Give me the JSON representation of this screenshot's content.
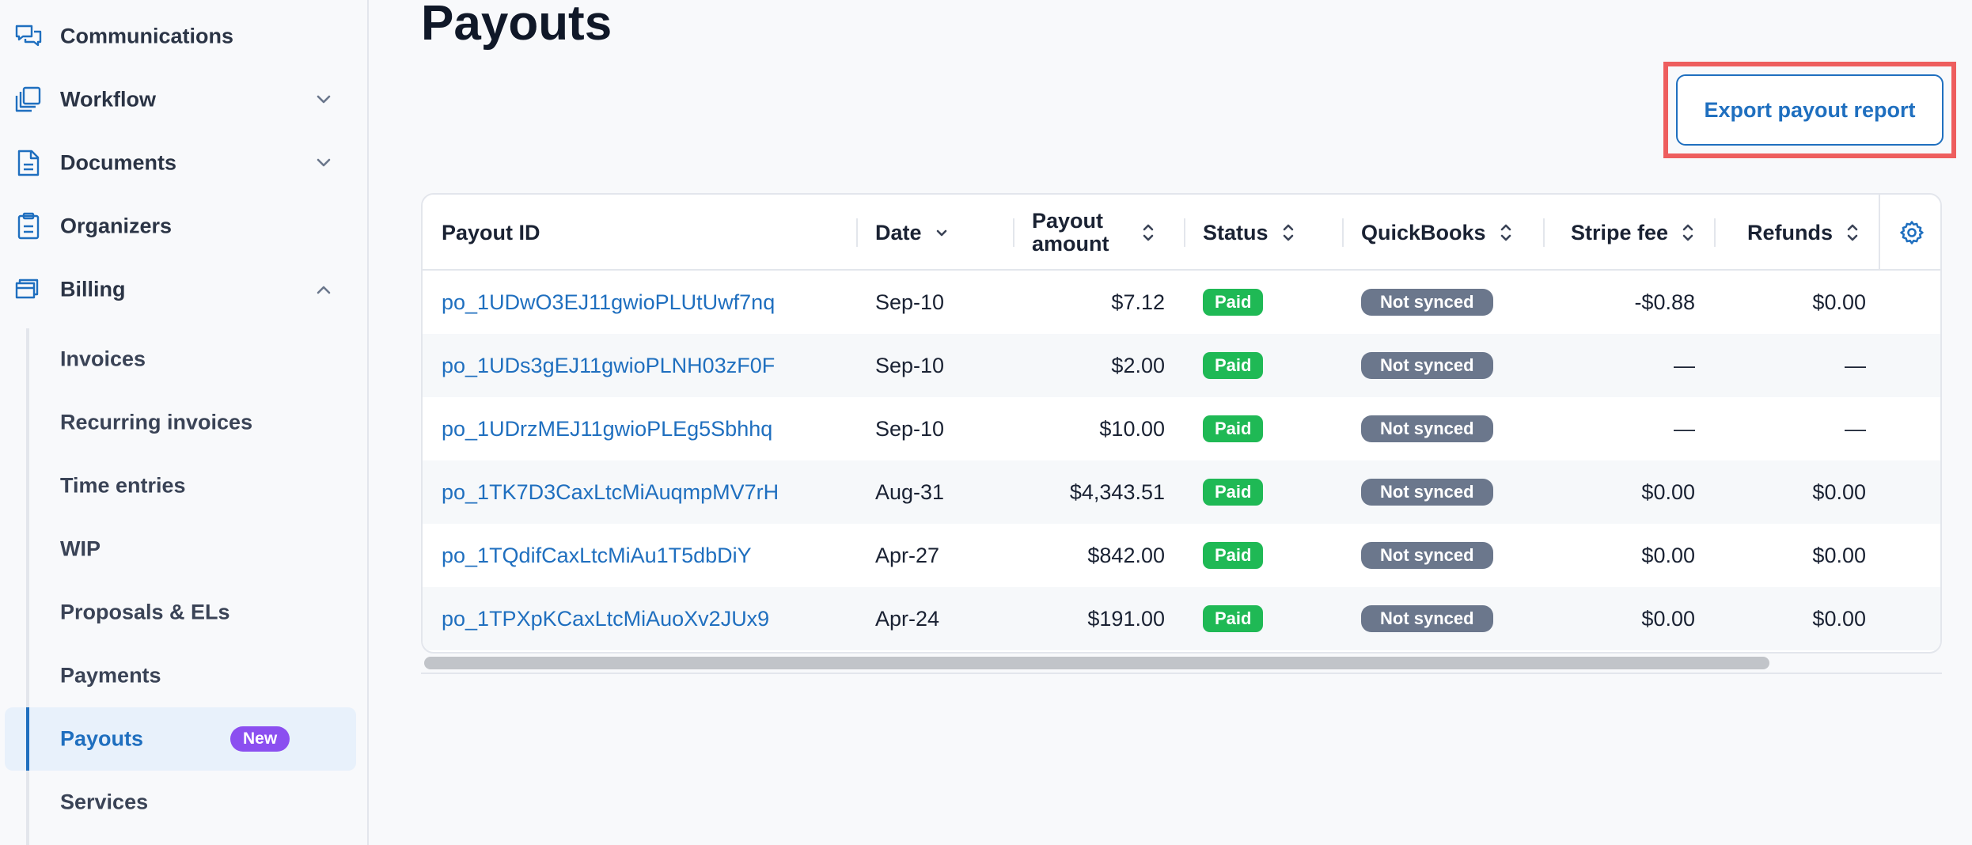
{
  "sidebar": {
    "items": [
      {
        "label": "Communications",
        "icon": "chat-bubbles-icon"
      },
      {
        "label": "Workflow",
        "icon": "workflow-icon"
      },
      {
        "label": "Documents",
        "icon": "document-icon"
      },
      {
        "label": "Organizers",
        "icon": "clipboard-icon"
      },
      {
        "label": "Billing",
        "icon": "billing-icon"
      }
    ],
    "billing_sub": [
      {
        "label": "Invoices"
      },
      {
        "label": "Recurring invoices"
      },
      {
        "label": "Time entries"
      },
      {
        "label": "WIP"
      },
      {
        "label": "Proposals & ELs"
      },
      {
        "label": "Payments"
      },
      {
        "label": "Payouts",
        "badge": "New"
      },
      {
        "label": "Services"
      }
    ]
  },
  "page": {
    "title": "Payouts",
    "export_label": "Export payout report"
  },
  "table": {
    "headers": {
      "payout_id": "Payout ID",
      "date": "Date",
      "amount": "Payout amount",
      "status": "Status",
      "quickbooks": "QuickBooks",
      "stripe_fee": "Stripe fee",
      "refunds": "Refunds"
    },
    "rows": [
      {
        "id": "po_1UDwO3EJ11gwioPLUtUwf7nq",
        "date": "Sep-10",
        "amount": "$7.12",
        "status": "Paid",
        "qb": "Not synced",
        "fee": "-$0.88",
        "refunds": "$0.00"
      },
      {
        "id": "po_1UDs3gEJ11gwioPLNH03zF0F",
        "date": "Sep-10",
        "amount": "$2.00",
        "status": "Paid",
        "qb": "Not synced",
        "fee": "—",
        "refunds": "—"
      },
      {
        "id": "po_1UDrzMEJ11gwioPLEg5Sbhhq",
        "date": "Sep-10",
        "amount": "$10.00",
        "status": "Paid",
        "qb": "Not synced",
        "fee": "—",
        "refunds": "—"
      },
      {
        "id": "po_1TK7D3CaxLtcMiAuqmpMV7rH",
        "date": "Aug-31",
        "amount": "$4,343.51",
        "status": "Paid",
        "qb": "Not synced",
        "fee": "$0.00",
        "refunds": "$0.00"
      },
      {
        "id": "po_1TQdifCaxLtcMiAu1T5dbDiY",
        "date": "Apr-27",
        "amount": "$842.00",
        "status": "Paid",
        "qb": "Not synced",
        "fee": "$0.00",
        "refunds": "$0.00"
      },
      {
        "id": "po_1TPXpKCaxLtcMiAuoXv2JUx9",
        "date": "Apr-24",
        "amount": "$191.00",
        "status": "Paid",
        "qb": "Not synced",
        "fee": "$0.00",
        "refunds": "$0.00"
      }
    ]
  },
  "colors": {
    "accent": "#1f6fbf",
    "paid": "#1fb955",
    "not_synced": "#6b778c",
    "badge_new": "#8b4ff0",
    "highlight_box": "#ee5e5e"
  }
}
